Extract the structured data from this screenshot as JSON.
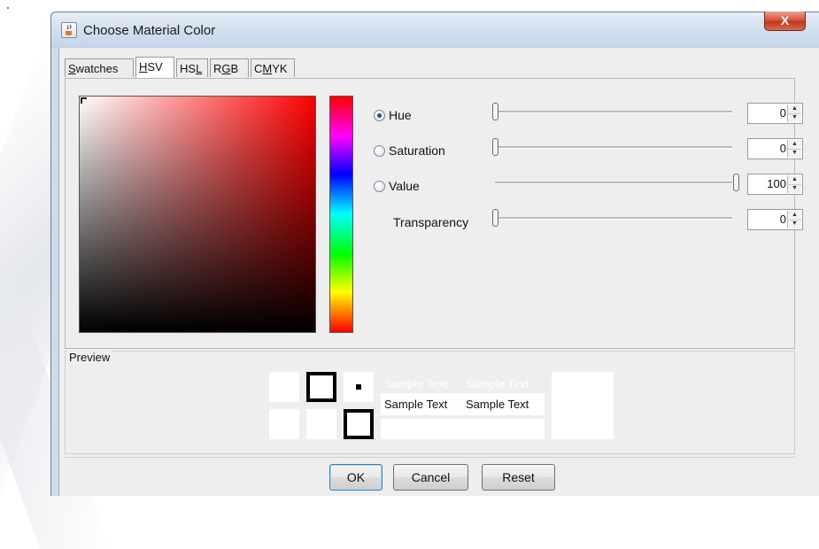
{
  "window": {
    "title": "Choose Material Color",
    "close_glyph": "X",
    "app_icon": "java-cup-icon"
  },
  "tabs": [
    {
      "pre": "",
      "u": "S",
      "post": "watches",
      "active": false
    },
    {
      "pre": "",
      "u": "H",
      "post": "SV",
      "active": true
    },
    {
      "pre": "HS",
      "u": "L",
      "post": "",
      "active": false
    },
    {
      "pre": "R",
      "u": "G",
      "post": "B",
      "active": false
    },
    {
      "pre": "C",
      "u": "M",
      "post": "YK",
      "active": false
    }
  ],
  "hsv": {
    "hue": {
      "label": "Hue",
      "value": "0",
      "selected": true,
      "level": 0
    },
    "saturation": {
      "label": "Saturation",
      "value": "0",
      "selected": false,
      "level": 0
    },
    "value": {
      "label": "Value",
      "value": "100",
      "selected": false,
      "level": 1
    },
    "transparency": {
      "label": "Transparency",
      "value": "0",
      "level": 0
    }
  },
  "preview": {
    "title": "Preview",
    "sample_text": "Sample Text"
  },
  "buttons": {
    "ok": "OK",
    "cancel": "Cancel",
    "reset": "Reset"
  },
  "colors": {
    "current_color": "#ff0000",
    "title_bar": "#cfdbe9",
    "close_button": "#c1391d"
  }
}
